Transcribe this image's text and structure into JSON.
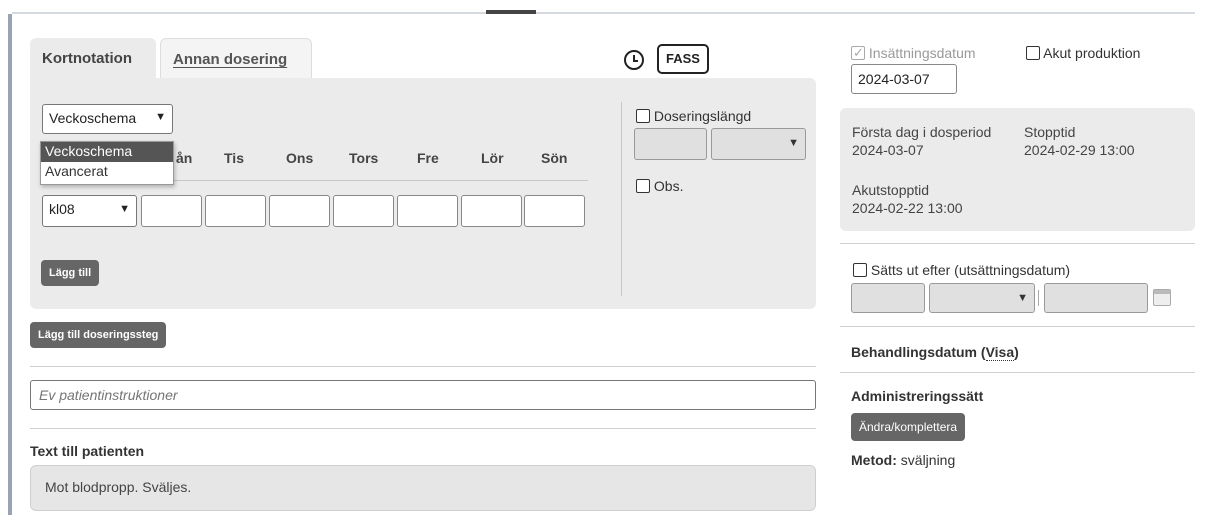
{
  "tabs": {
    "kortnotation": "Kortnotation",
    "annan_dosering": "Annan dosering"
  },
  "fass_label": "FASS",
  "schema_select": {
    "value": "Veckoschema",
    "options": [
      "Veckoschema",
      "Avancerat"
    ]
  },
  "days": {
    "man_partial": "ån",
    "tis": "Tis",
    "ons": "Ons",
    "tors": "Tors",
    "fre": "Fre",
    "lor": "Lör",
    "son": "Sön"
  },
  "time_select": {
    "value": "kl08"
  },
  "lagg_till": "Lägg till",
  "doseringslangd": "Doseringslängd",
  "obs": "Obs.",
  "lagg_till_doseringssteg": "Lägg till doseringssteg",
  "patient_instructions": {
    "placeholder": "Ev patientinstruktioner"
  },
  "text_till_patienten": {
    "label": "Text till patienten",
    "value": "Mot blodpropp. Sväljes."
  },
  "right": {
    "insattningsdatum_label": "Insättningsdatum",
    "insattningsdatum_value": "2024-03-07",
    "akut_produktion": "Akut produktion",
    "forsta_dag_label": "Första dag i dosperiod",
    "forsta_dag_value": "2024-03-07",
    "stopptid_label": "Stopptid",
    "stopptid_value": "2024-02-29 13:00",
    "akutstopptid_label": "Akutstopptid",
    "akutstopptid_value": "2024-02-22 13:00",
    "satts_ut_efter": "Sätts ut efter (utsättningsdatum)",
    "behandlingsdatum_prefix": "Behandlingsdatum (",
    "behandlingsdatum_link": "Visa",
    "behandlingsdatum_suffix": ")",
    "administreringssatt": "Administreringssätt",
    "andra_komplettera": "Ändra/komplettera",
    "metod_label": "Metod:",
    "metod_value": "sväljning"
  },
  "icons": [
    "clock-icon",
    "calendar-icon",
    "chevron-down-icon",
    "checkmark-icon"
  ]
}
